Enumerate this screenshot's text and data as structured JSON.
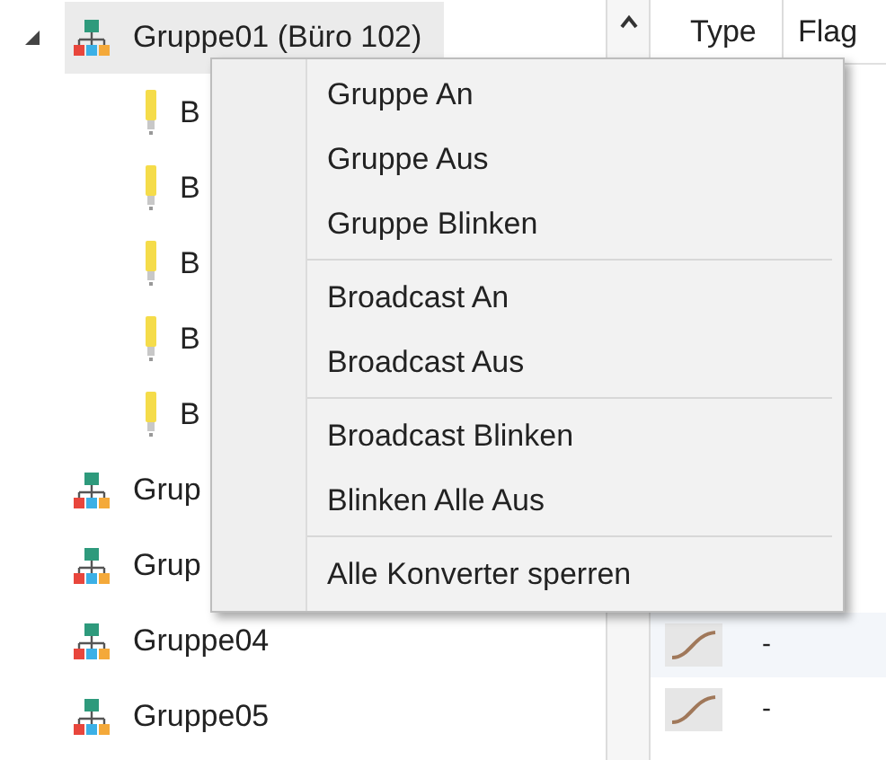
{
  "tree": [
    {
      "label": "Gruppe01 (Büro 102)",
      "kind": "group",
      "selected": true,
      "expanded": true,
      "children": [
        {
          "label": "B",
          "kind": "lamp"
        },
        {
          "label": "B",
          "kind": "lamp"
        },
        {
          "label": "B",
          "kind": "lamp"
        },
        {
          "label": "B",
          "kind": "lamp"
        },
        {
          "label": "B",
          "kind": "lamp"
        }
      ]
    },
    {
      "label": "Grup",
      "kind": "group",
      "selected": false,
      "expanded": false
    },
    {
      "label": "Grup",
      "kind": "group",
      "selected": false,
      "expanded": false
    },
    {
      "label": "Gruppe04",
      "kind": "group",
      "selected": false,
      "expanded": false
    },
    {
      "label": "Gruppe05",
      "kind": "group",
      "selected": false,
      "expanded": false
    }
  ],
  "table": {
    "columns": [
      "Type",
      "Flag"
    ],
    "rows": [
      {
        "column_2": "-"
      },
      {
        "column_2": "-"
      }
    ]
  },
  "context_menu": [
    [
      "Gruppe An",
      "Gruppe Aus",
      "Gruppe Blinken"
    ],
    [
      "Broadcast An",
      "Broadcast Aus"
    ],
    [
      "Broadcast Blinken",
      "Blinken Alle Aus"
    ],
    [
      "Alle Konverter sperren"
    ]
  ]
}
